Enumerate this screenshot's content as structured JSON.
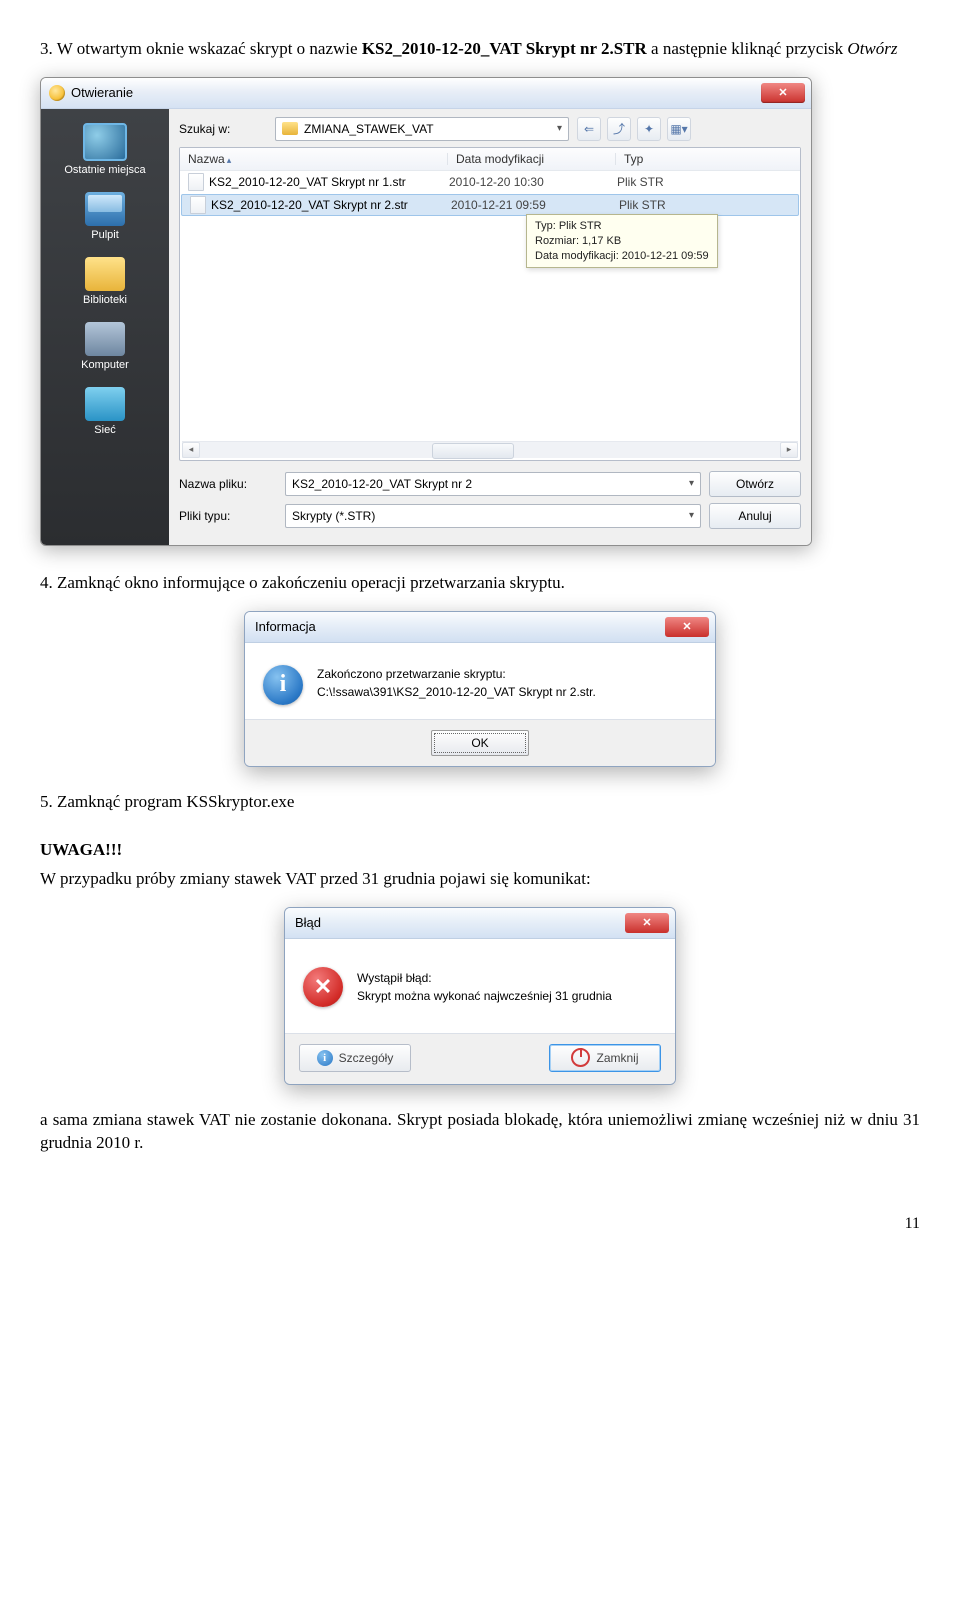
{
  "step3": {
    "num": "3.",
    "text_before": "W otwartym oknie wskazać skrypt o nazwie ",
    "bold": "KS2_2010-12-20_VAT Skrypt nr 2.STR",
    "text_after": " a następnie kliknąć przycisk ",
    "italic": "Otwórz"
  },
  "open_dialog": {
    "title": "Otwieranie",
    "lookin_label": "Szukaj w:",
    "lookin_value": "ZMIANA_STAWEK_VAT",
    "places": [
      "Ostatnie miejsca",
      "Pulpit",
      "Biblioteki",
      "Komputer",
      "Sieć"
    ],
    "columns": {
      "name": "Nazwa",
      "date": "Data modyfikacji",
      "type": "Typ"
    },
    "files": [
      {
        "name": "KS2_2010-12-20_VAT Skrypt nr 1.str",
        "date": "2010-12-20 10:30",
        "type": "Plik STR"
      },
      {
        "name": "KS2_2010-12-20_VAT Skrypt nr 2.str",
        "date": "2010-12-21 09:59",
        "type": "Plik STR"
      }
    ],
    "tooltip": {
      "l1": "Typ: Plik STR",
      "l2": "Rozmiar: 1,17 KB",
      "l3": "Data modyfikacji: 2010-12-21 09:59"
    },
    "filename_label": "Nazwa pliku:",
    "filename_value": "KS2_2010-12-20_VAT Skrypt nr 2",
    "filetype_label": "Pliki typu:",
    "filetype_value": "Skrypty (*.STR)",
    "open_btn": "Otwórz",
    "cancel_btn": "Anuluj"
  },
  "step4": {
    "num": "4.",
    "text": "Zamknąć okno informujące o zakończeniu operacji przetwarzania skryptu."
  },
  "info_dialog": {
    "title": "Informacja",
    "line1": "Zakończono przetwarzanie skryptu:",
    "line2": "C:\\!ssawa\\391\\KS2_2010-12-20_VAT Skrypt nr 2.str.",
    "ok": "OK"
  },
  "step5": {
    "num": "5.",
    "text": "Zamknąć program KSSkryptor.exe"
  },
  "uwaga": "UWAGA!!!",
  "uwaga_text": "W przypadku próby zmiany stawek VAT przed 31 grudnia pojawi się komunikat:",
  "err_dialog": {
    "title": "Błąd",
    "line1": "Wystąpił błąd:",
    "line2": "Skrypt można wykonać najwcześniej 31 grudnia",
    "details": "Szczegóły",
    "close": "Zamknij"
  },
  "closing_para": "a sama zmiana stawek VAT nie zostanie dokonana. Skrypt posiada blokadę, która uniemożliwi zmianę wcześniej niż w dniu 31 grudnia 2010 r.",
  "page_number": "11"
}
